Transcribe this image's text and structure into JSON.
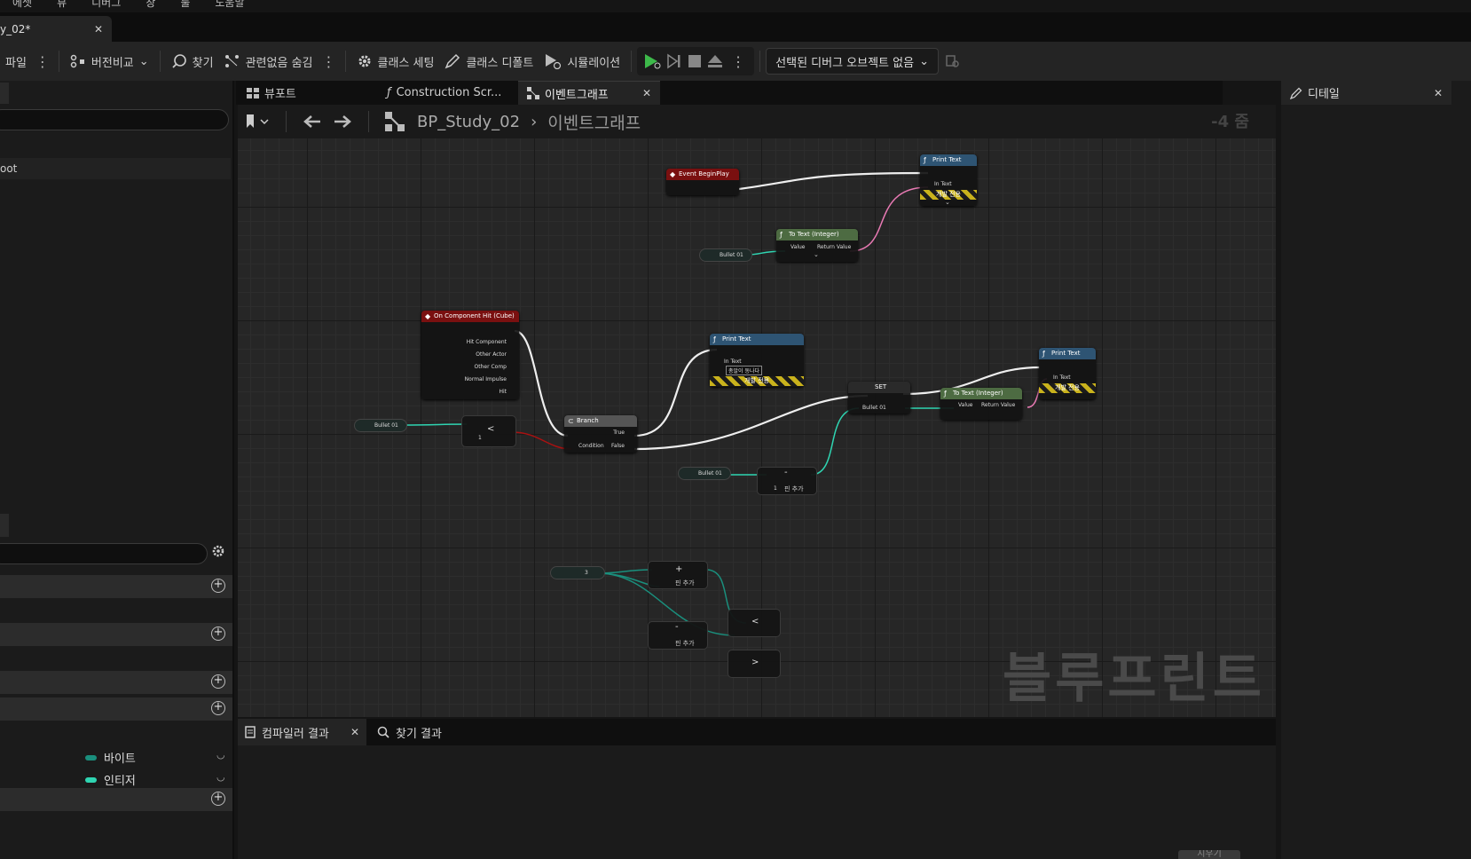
{
  "menu": [
    "에셋",
    "뷰",
    "디버그",
    "창",
    "툴",
    "도움말"
  ],
  "asset_tab": {
    "label": "y_02*"
  },
  "toolbar": {
    "compile": "파일",
    "diff": "버전비교",
    "find": "찾기",
    "hide_unrelated": "관련없음 숨김",
    "class_settings": "클래스 세팅",
    "class_defaults": "클래스 디폴트",
    "simulation": "시뮬레이션",
    "debug_object": "선택된 디버그 오브젝트 없음"
  },
  "left_panel": {
    "root_item": "oot",
    "variables": [
      {
        "name": "바이트",
        "color": "#1a8f7d"
      },
      {
        "name": "인티저",
        "color": "#2fd5b2"
      }
    ]
  },
  "graph_tabs": [
    {
      "label": "뷰포트",
      "icon": "grid-icon"
    },
    {
      "label": "Construction Scr...",
      "icon": "function-icon"
    },
    {
      "label": "이벤트그래프",
      "icon": "graph-icon"
    }
  ],
  "breadcrumb": {
    "blueprint": "BP_Study_02",
    "graph": "이벤트그래프"
  },
  "zoom_label": "-4 줌",
  "watermark": "블루프린트",
  "nodes": {
    "begin_play": "Event BeginPlay",
    "print1_title": "Print Text",
    "print1_pin": "In Text",
    "dev_only": "개발 전용",
    "totext1_title": "To Text (Integer)",
    "totext_value": "Value",
    "totext_return": "Return Value",
    "bullet": "Bullet 01",
    "hit_title": "On Component Hit (Cube)",
    "hit_pins": [
      "Hit Component",
      "Other Actor",
      "Other Comp",
      "Normal Impulse",
      "Hit"
    ],
    "branch_title": "Branch",
    "branch_true": "True",
    "branch_false": "False",
    "branch_cond": "Condition",
    "print2_title": "Print Text",
    "print2_pin": "In Text",
    "print2_text": "총알이 동나다",
    "set_title": "SET",
    "totext2_title": "To Text (Integer)",
    "print3_title": "Print Text",
    "print3_pin": "In Text",
    "add_pin": "핀 추가",
    "three": "3",
    "one": "1"
  },
  "details_tab": "디테일",
  "bottom_tabs": {
    "compiler": "컴파일러 결과",
    "find": "찾기 결과"
  },
  "clear_label": "지우기"
}
